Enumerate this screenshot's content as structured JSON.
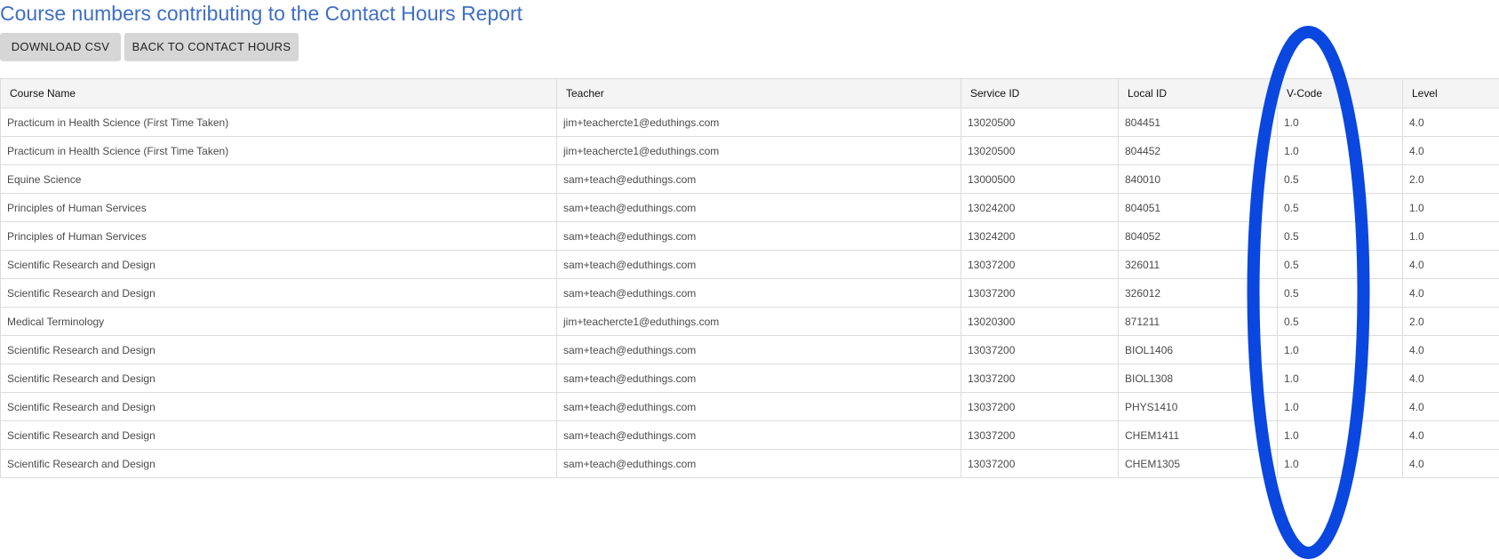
{
  "page": {
    "title": "Course numbers contributing to the Contact Hours Report"
  },
  "toolbar": {
    "download_label": "DOWNLOAD CSV",
    "back_label": "BACK TO CONTACT HOURS"
  },
  "table": {
    "columns": [
      "Course Name",
      "Teacher",
      "Service ID",
      "Local ID",
      "V-Code",
      "Level"
    ],
    "rows": [
      [
        "Practicum in Health Science (First Time Taken)",
        "jim+teachercte1@eduthings.com",
        "13020500",
        "804451",
        "1.0",
        "4.0"
      ],
      [
        "Practicum in Health Science (First Time Taken)",
        "jim+teachercte1@eduthings.com",
        "13020500",
        "804452",
        "1.0",
        "4.0"
      ],
      [
        "Equine Science",
        "sam+teach@eduthings.com",
        "13000500",
        "840010",
        "0.5",
        "2.0"
      ],
      [
        "Principles of Human Services",
        "sam+teach@eduthings.com",
        "13024200",
        "804051",
        "0.5",
        "1.0"
      ],
      [
        "Principles of Human Services",
        "sam+teach@eduthings.com",
        "13024200",
        "804052",
        "0.5",
        "1.0"
      ],
      [
        "Scientific Research and Design",
        "sam+teach@eduthings.com",
        "13037200",
        "326011",
        "0.5",
        "4.0"
      ],
      [
        "Scientific Research and Design",
        "sam+teach@eduthings.com",
        "13037200",
        "326012",
        "0.5",
        "4.0"
      ],
      [
        "Medical Terminology",
        "jim+teachercte1@eduthings.com",
        "13020300",
        "871211",
        "0.5",
        "2.0"
      ],
      [
        "Scientific Research and Design",
        "sam+teach@eduthings.com",
        "13037200",
        "BIOL1406",
        "1.0",
        "4.0"
      ],
      [
        "Scientific Research and Design",
        "sam+teach@eduthings.com",
        "13037200",
        "BIOL1308",
        "1.0",
        "4.0"
      ],
      [
        "Scientific Research and Design",
        "sam+teach@eduthings.com",
        "13037200",
        "PHYS1410",
        "1.0",
        "4.0"
      ],
      [
        "Scientific Research and Design",
        "sam+teach@eduthings.com",
        "13037200",
        "CHEM1411",
        "1.0",
        "4.0"
      ],
      [
        "Scientific Research and Design",
        "sam+teach@eduthings.com",
        "13037200",
        "CHEM1305",
        "1.0",
        "4.0"
      ]
    ]
  },
  "colors": {
    "title": "#3f6fc4",
    "button_bg": "#d6d6d6",
    "annotation": "#0a47e0"
  }
}
